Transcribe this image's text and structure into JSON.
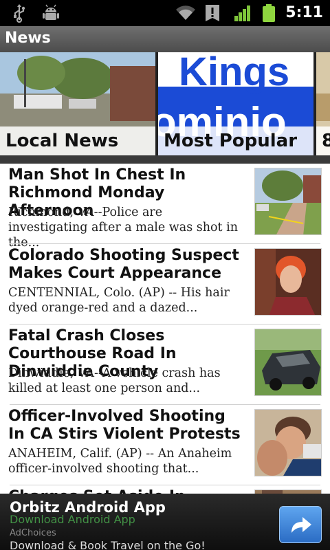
{
  "status_bar": {
    "time": "5:11",
    "icons": [
      "usb-icon",
      "android-debug-icon",
      "wifi-icon",
      "alert-icon",
      "signal-icon",
      "battery-icon"
    ]
  },
  "app": {
    "title": "News"
  },
  "categories": [
    {
      "label": "Local News"
    },
    {
      "label": "Most Popular"
    },
    {
      "label": "8"
    }
  ],
  "articles": [
    {
      "headline": "Man Shot In Chest In Richmond Monday Afternoon",
      "summary": "Richmond, VA--Police are investigating after a male was shot in the..."
    },
    {
      "headline": "Colorado Shooting Suspect Makes Court Appearance",
      "summary": "CENTENNIAL, Colo. (AP) -- His hair dyed orange-red and a dazed..."
    },
    {
      "headline": "Fatal Crash Closes Courthouse Road In Dinwiddie County",
      "summary": "Dinwiddie, VA--A vehicle crash has killed at least one person and..."
    },
    {
      "headline": "Officer-Involved Shooting In CA Stirs Violent Protests",
      "summary": "ANAHEIM, Calif. (AP) -- An Anaheim officer-involved shooting that..."
    },
    {
      "headline": "Charges Set Aside In",
      "summary": ""
    }
  ],
  "ad": {
    "title": "Orbitz Android App",
    "subtitle": "Download Android App",
    "choices": "AdChoices",
    "description": "Download & Book Travel on the Go!"
  },
  "colors": {
    "title_bar": "#5a5a5a",
    "ad_button": "#3b82d6",
    "ad_subtitle": "#4caf50"
  }
}
